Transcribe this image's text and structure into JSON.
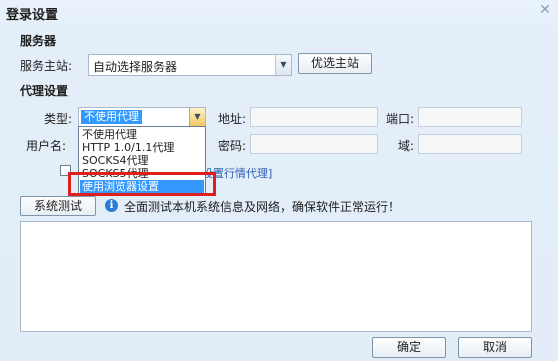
{
  "window": {
    "title": "登录设置",
    "close_glyph": "✕"
  },
  "server": {
    "section_label": "服务器",
    "host_label": "服务主站:",
    "host_value": "自动选择服务器",
    "preferred_button": "优选主站"
  },
  "proxy": {
    "section_label": "代理设置",
    "type_label": "类型:",
    "type_value": "不使用代理",
    "address_label": "地址:",
    "port_label": "端口:",
    "username_label": "用户名:",
    "password_label": "密码:",
    "domain_label": "域:",
    "options": [
      "不使用代理",
      "HTTP 1.0/1.1代理",
      "SOCKS4代理",
      "SOCKS5代理",
      "使用浏览器设置"
    ],
    "highlighted_option_index": 4,
    "quote_proxy_link": "设置行情代理]"
  },
  "system_test": {
    "button_label": "系统测试",
    "info_icon_glyph": "i",
    "description": "全面测试本机系统信息及网络，确保软件正常运行！"
  },
  "footer": {
    "ok_label": "确定",
    "cancel_label": "取消"
  }
}
